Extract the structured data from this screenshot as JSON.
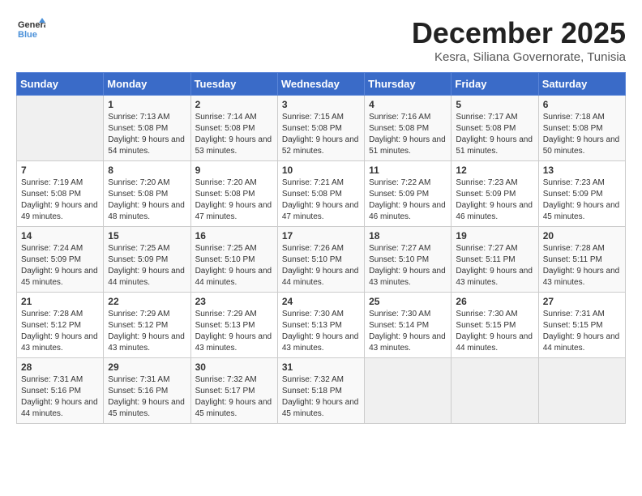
{
  "logo": {
    "line1": "General",
    "line2": "Blue"
  },
  "title": "December 2025",
  "subtitle": "Kesra, Siliana Governorate, Tunisia",
  "days_of_week": [
    "Sunday",
    "Monday",
    "Tuesday",
    "Wednesday",
    "Thursday",
    "Friday",
    "Saturday"
  ],
  "weeks": [
    [
      {
        "day": "",
        "sunrise": "",
        "sunset": "",
        "daylight": ""
      },
      {
        "day": "1",
        "sunrise": "7:13 AM",
        "sunset": "5:08 PM",
        "daylight": "9 hours and 54 minutes."
      },
      {
        "day": "2",
        "sunrise": "7:14 AM",
        "sunset": "5:08 PM",
        "daylight": "9 hours and 53 minutes."
      },
      {
        "day": "3",
        "sunrise": "7:15 AM",
        "sunset": "5:08 PM",
        "daylight": "9 hours and 52 minutes."
      },
      {
        "day": "4",
        "sunrise": "7:16 AM",
        "sunset": "5:08 PM",
        "daylight": "9 hours and 51 minutes."
      },
      {
        "day": "5",
        "sunrise": "7:17 AM",
        "sunset": "5:08 PM",
        "daylight": "9 hours and 51 minutes."
      },
      {
        "day": "6",
        "sunrise": "7:18 AM",
        "sunset": "5:08 PM",
        "daylight": "9 hours and 50 minutes."
      }
    ],
    [
      {
        "day": "7",
        "sunrise": "7:19 AM",
        "sunset": "5:08 PM",
        "daylight": "9 hours and 49 minutes."
      },
      {
        "day": "8",
        "sunrise": "7:20 AM",
        "sunset": "5:08 PM",
        "daylight": "9 hours and 48 minutes."
      },
      {
        "day": "9",
        "sunrise": "7:20 AM",
        "sunset": "5:08 PM",
        "daylight": "9 hours and 47 minutes."
      },
      {
        "day": "10",
        "sunrise": "7:21 AM",
        "sunset": "5:08 PM",
        "daylight": "9 hours and 47 minutes."
      },
      {
        "day": "11",
        "sunrise": "7:22 AM",
        "sunset": "5:09 PM",
        "daylight": "9 hours and 46 minutes."
      },
      {
        "day": "12",
        "sunrise": "7:23 AM",
        "sunset": "5:09 PM",
        "daylight": "9 hours and 46 minutes."
      },
      {
        "day": "13",
        "sunrise": "7:23 AM",
        "sunset": "5:09 PM",
        "daylight": "9 hours and 45 minutes."
      }
    ],
    [
      {
        "day": "14",
        "sunrise": "7:24 AM",
        "sunset": "5:09 PM",
        "daylight": "9 hours and 45 minutes."
      },
      {
        "day": "15",
        "sunrise": "7:25 AM",
        "sunset": "5:09 PM",
        "daylight": "9 hours and 44 minutes."
      },
      {
        "day": "16",
        "sunrise": "7:25 AM",
        "sunset": "5:10 PM",
        "daylight": "9 hours and 44 minutes."
      },
      {
        "day": "17",
        "sunrise": "7:26 AM",
        "sunset": "5:10 PM",
        "daylight": "9 hours and 44 minutes."
      },
      {
        "day": "18",
        "sunrise": "7:27 AM",
        "sunset": "5:10 PM",
        "daylight": "9 hours and 43 minutes."
      },
      {
        "day": "19",
        "sunrise": "7:27 AM",
        "sunset": "5:11 PM",
        "daylight": "9 hours and 43 minutes."
      },
      {
        "day": "20",
        "sunrise": "7:28 AM",
        "sunset": "5:11 PM",
        "daylight": "9 hours and 43 minutes."
      }
    ],
    [
      {
        "day": "21",
        "sunrise": "7:28 AM",
        "sunset": "5:12 PM",
        "daylight": "9 hours and 43 minutes."
      },
      {
        "day": "22",
        "sunrise": "7:29 AM",
        "sunset": "5:12 PM",
        "daylight": "9 hours and 43 minutes."
      },
      {
        "day": "23",
        "sunrise": "7:29 AM",
        "sunset": "5:13 PM",
        "daylight": "9 hours and 43 minutes."
      },
      {
        "day": "24",
        "sunrise": "7:30 AM",
        "sunset": "5:13 PM",
        "daylight": "9 hours and 43 minutes."
      },
      {
        "day": "25",
        "sunrise": "7:30 AM",
        "sunset": "5:14 PM",
        "daylight": "9 hours and 43 minutes."
      },
      {
        "day": "26",
        "sunrise": "7:30 AM",
        "sunset": "5:15 PM",
        "daylight": "9 hours and 44 minutes."
      },
      {
        "day": "27",
        "sunrise": "7:31 AM",
        "sunset": "5:15 PM",
        "daylight": "9 hours and 44 minutes."
      }
    ],
    [
      {
        "day": "28",
        "sunrise": "7:31 AM",
        "sunset": "5:16 PM",
        "daylight": "9 hours and 44 minutes."
      },
      {
        "day": "29",
        "sunrise": "7:31 AM",
        "sunset": "5:16 PM",
        "daylight": "9 hours and 45 minutes."
      },
      {
        "day": "30",
        "sunrise": "7:32 AM",
        "sunset": "5:17 PM",
        "daylight": "9 hours and 45 minutes."
      },
      {
        "day": "31",
        "sunrise": "7:32 AM",
        "sunset": "5:18 PM",
        "daylight": "9 hours and 45 minutes."
      },
      {
        "day": "",
        "sunrise": "",
        "sunset": "",
        "daylight": ""
      },
      {
        "day": "",
        "sunrise": "",
        "sunset": "",
        "daylight": ""
      },
      {
        "day": "",
        "sunrise": "",
        "sunset": "",
        "daylight": ""
      }
    ]
  ]
}
